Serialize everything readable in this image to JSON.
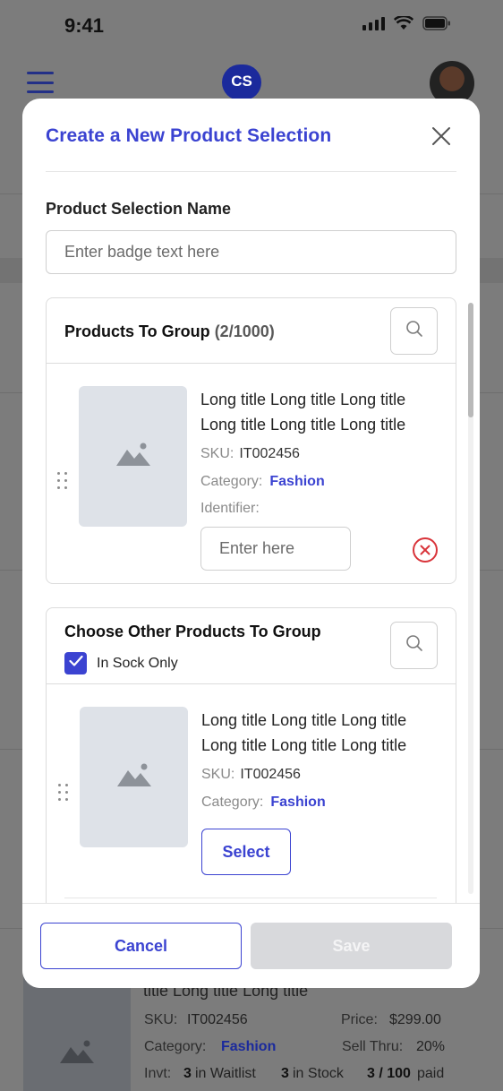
{
  "status_bar": {
    "time": "9:41"
  },
  "app_bar": {
    "logo_text": "CS"
  },
  "background_card": {
    "title_fragment": "title Long title Long title",
    "sku_label": "SKU:",
    "sku_value": "IT002456",
    "price_label": "Price:",
    "price_value": "$299.00",
    "category_label": "Category:",
    "category_value": "Fashion",
    "sell_thru_label": "Sell Thru:",
    "sell_thru_value": "20%",
    "invt_label": "Invt:",
    "waitlist_count": "3",
    "waitlist_label": "in Waitlist",
    "stock_count": "3",
    "stock_label": "in Stock",
    "paid_count": "3 / 100",
    "paid_label": "paid"
  },
  "modal": {
    "title": "Create a New Product Selection",
    "name_label": "Product Selection Name",
    "name_placeholder": "Enter badge text here",
    "products_panel": {
      "title": "Products To Group",
      "count": "(2/1000)",
      "item": {
        "title": "Long title Long title Long title Long title Long title Long title",
        "sku_label": "SKU:",
        "sku_value": "IT002456",
        "category_label": "Category:",
        "category_value": "Fashion",
        "identifier_label": "Identifier:",
        "identifier_placeholder": "Enter here"
      }
    },
    "other_panel": {
      "title": "Choose Other Products To Group",
      "checkbox_label": "In Sock Only",
      "checkbox_checked": true,
      "item": {
        "title": "Long title Long title Long title Long title Long title Long title",
        "sku_label": "SKU:",
        "sku_value": "IT002456",
        "category_label": "Category:",
        "category_value": "Fashion",
        "select_label": "Select"
      }
    },
    "footer": {
      "cancel_label": "Cancel",
      "save_label": "Save"
    }
  },
  "colors": {
    "accent": "#3b43d1",
    "brand_logo": "#1b2a9c",
    "danger": "#d9343a",
    "placeholder_tile": "#dee2e8",
    "disabled_button": "#d8d9dc",
    "overlay": "#7c7c7c"
  },
  "icons": [
    "menu-icon",
    "close-icon",
    "search-icon",
    "image-placeholder-icon",
    "drag-handle-icon",
    "remove-circle-icon",
    "checkmark-icon",
    "signal-icon",
    "wifi-icon",
    "battery-icon"
  ]
}
